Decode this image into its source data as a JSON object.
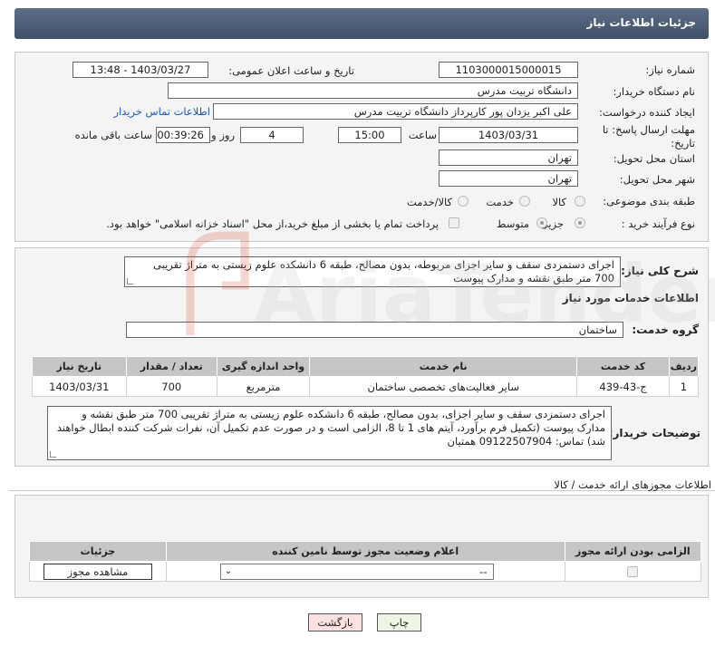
{
  "page": {
    "title": "جزئیات اطلاعات نیاز"
  },
  "form": {
    "need_number_label": "شماره نیاز:",
    "need_number": "1103000015000015",
    "announce_label": "تاریخ و ساعت اعلان عمومی:",
    "announce_value": "1403/03/27 - 13:48",
    "buyer_org_label": "نام دستگاه خریدار:",
    "buyer_org": "دانشگاه تربیت مدرس",
    "creator_label": "ایجاد کننده درخواست:",
    "creator": "علی اکبر یزدان پور کارپرداز دانشگاه تربیت مدرس",
    "buyer_contact_link": "اطلاعات تماس خریدار",
    "deadline_label_1": "مهلت ارسال پاسخ: تا",
    "deadline_label_2": "تاریخ:",
    "deadline_date": "1403/03/31",
    "time_label": "ساعت",
    "deadline_time": "15:00",
    "days_value": "4",
    "days_label": "روز و",
    "remaining_time": "00:39:26",
    "remaining_label": "ساعت باقی مانده",
    "province_label": "استان محل تحویل:",
    "province": "تهران",
    "city_label": "شهر محل تحویل:",
    "city": "تهران",
    "category_label": "طبقه بندی موضوعی:",
    "category_options": [
      "کالا",
      "خدمت",
      "کالا/خدمت"
    ],
    "process_label": "نوع فرآیند خرید :",
    "process_options": [
      "جزیی",
      "متوسط"
    ],
    "payment_note": "پرداخت تمام یا بخشی از مبلغ خرید،از محل \"اسناد خزانه اسلامی\" خواهد بود."
  },
  "summary": {
    "label": "شرح کلی نیاز:",
    "text": "اجرای دستمزدی سقف و سایر اجزای مربوطه، بدون مصالح، طبقه 6 دانشکده علوم زیستی به متراژ تقریبی 700 متر طبق نقشه و مدارک پیوست"
  },
  "services": {
    "section_title": "اطلاعات خدمات مورد نیاز",
    "group_label": "گروه خدمت:",
    "group_value": "ساختمان",
    "headers": [
      "ردیف",
      "کد خدمت",
      "نام خدمت",
      "واحد اندازه گیری",
      "تعداد / مقدار",
      "تاریخ نیاز"
    ],
    "rows": [
      [
        "1",
        "ج-43-439",
        "سایر فعالیت‌های تخصصی ساختمان",
        "مترمربع",
        "700",
        "1403/03/31"
      ]
    ]
  },
  "buyer_notes": {
    "label": "توضیحات خریدار:",
    "text": "اجرای دستمزدی سقف و سایر اجزای، بدون مصالح، طبقه 6 دانشکده علوم زیستی به متراژ تقریبی 700 متر طبق نقشه و مدارک پیوست (تکمیل فرم برآورد، آیتم های 1 تا 8، الزامی است و در صورت عدم تکمیل آن، نفرات شرکت کننده ابطال خواهند شد) تماس: 09122507904 همتیان"
  },
  "permits": {
    "section_title": "اطلاعات مجوزهای ارائه خدمت / کالا",
    "headers": [
      "الزامی بودن ارائه مجوز",
      "اعلام وضعیت مجوز توسط نامین کننده",
      "جزئیات"
    ],
    "select_value": "--",
    "view_button": "مشاهده مجوز"
  },
  "actions": {
    "print": "چاپ",
    "back": "بازگشت"
  },
  "watermark": "AriaTender.neT"
}
